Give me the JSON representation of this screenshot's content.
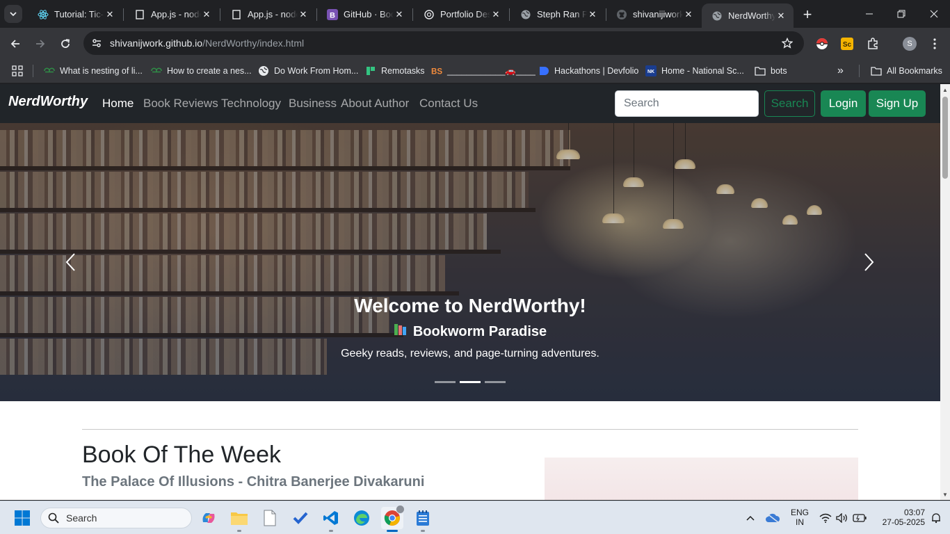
{
  "browser": {
    "tabs": [
      {
        "title": "Tutorial: Tic-Tac-Toe",
        "favicon": "react-icon",
        "active": false
      },
      {
        "title": "App.js - node",
        "favicon": "page-icon",
        "active": false
      },
      {
        "title": "App.js - node",
        "favicon": "page-icon",
        "active": false
      },
      {
        "title": "GitHub · Bootstrap",
        "favicon": "bootstrap-icon",
        "active": false
      },
      {
        "title": "Portfolio Design",
        "favicon": "openai-icon",
        "active": false
      },
      {
        "title": "Steph Ran Portfolio",
        "favicon": "globe-icon",
        "active": false
      },
      {
        "title": "shivanijiwork",
        "favicon": "github-icon",
        "active": false
      },
      {
        "title": "NerdWorthy",
        "favicon": "globe-icon",
        "active": true
      }
    ],
    "address": {
      "host": "shivanijwork.github.io",
      "path": "/NerdWorthy/index.html"
    },
    "profile_initial": "S",
    "bookmarks": [
      {
        "label": "What is nesting of li...",
        "icon": "gfg-icon"
      },
      {
        "label": "How to create a nes...",
        "icon": "gfg-icon"
      },
      {
        "label": "Do Work From Hom...",
        "icon": "globe-icon"
      },
      {
        "label": "Remotasks",
        "icon": "remotasks-icon"
      },
      {
        "label": "____________🚗____",
        "icon": "bs-icon"
      },
      {
        "label": "Hackathons | Devfolio",
        "icon": "devfolio-icon"
      },
      {
        "label": "Home - National Sc...",
        "icon": "nsk-icon"
      },
      {
        "label": "bots",
        "icon": "folder-icon"
      }
    ],
    "all_bookmarks_label": "All Bookmarks"
  },
  "site": {
    "brand": "NerdWorthy",
    "nav": [
      "Home",
      "Book Reviews",
      "Technology",
      "Business",
      "About Author",
      "Contact Us"
    ],
    "search_placeholder": "Search",
    "search_button": "Search",
    "login_button": "Login",
    "signup_button": "Sign Up",
    "carousel": {
      "heading": "Welcome to NerdWorthy!",
      "subheading": "Bookworm Paradise",
      "text": "Geeky reads, reviews, and page-turning adventures.",
      "slide_count": 3,
      "active_slide": 2
    },
    "book_of_week": {
      "title": "Book Of The Week",
      "subtitle": "The Palace Of Illusions - Chitra Banerjee Divakaruni"
    }
  },
  "taskbar": {
    "search_label": "Search",
    "lang_line1": "ENG",
    "lang_line2": "IN",
    "time": "03:07",
    "date": "27-05-2025"
  },
  "colors": {
    "success": "#198754",
    "navbar": "#212529",
    "chrome_dark": "#202124"
  }
}
